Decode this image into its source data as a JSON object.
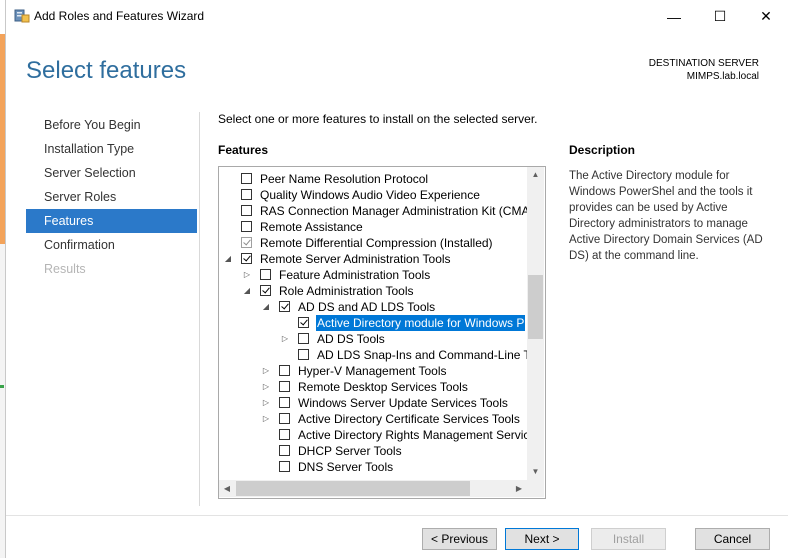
{
  "window": {
    "title": "Add Roles and Features Wizard",
    "controls": {
      "minimize": "—",
      "maximize": "☐",
      "close": "✕"
    }
  },
  "header": {
    "page_title": "Select features",
    "destination_label": "DESTINATION SERVER",
    "destination_server": "MIMPS.lab.local"
  },
  "nav": {
    "items": [
      {
        "label": "Before You Begin",
        "state": "normal"
      },
      {
        "label": "Installation Type",
        "state": "normal"
      },
      {
        "label": "Server Selection",
        "state": "normal"
      },
      {
        "label": "Server Roles",
        "state": "normal"
      },
      {
        "label": "Features",
        "state": "selected"
      },
      {
        "label": "Confirmation",
        "state": "normal"
      },
      {
        "label": "Results",
        "state": "disabled"
      }
    ]
  },
  "main": {
    "instruction": "Select one or more features to install on the selected server.",
    "features_heading": "Features",
    "features": [
      {
        "label": "Peer Name Resolution Protocol",
        "level": 0,
        "expander": "none",
        "checked": false,
        "disabled": false
      },
      {
        "label": "Quality Windows Audio Video Experience",
        "level": 0,
        "expander": "none",
        "checked": false,
        "disabled": false
      },
      {
        "label": "RAS Connection Manager Administration Kit (CMA",
        "level": 0,
        "expander": "none",
        "checked": false,
        "disabled": false
      },
      {
        "label": "Remote Assistance",
        "level": 0,
        "expander": "none",
        "checked": false,
        "disabled": false
      },
      {
        "label": "Remote Differential Compression (Installed)",
        "level": 0,
        "expander": "none",
        "checked": true,
        "disabled": true
      },
      {
        "label": "Remote Server Administration Tools",
        "level": 0,
        "expander": "expanded",
        "checked": true,
        "disabled": false
      },
      {
        "label": "Feature Administration Tools",
        "level": 1,
        "expander": "collapsed",
        "checked": false,
        "disabled": false
      },
      {
        "label": "Role Administration Tools",
        "level": 1,
        "expander": "expanded",
        "checked": true,
        "disabled": false
      },
      {
        "label": "AD DS and AD LDS Tools",
        "level": 2,
        "expander": "expanded",
        "checked": true,
        "disabled": false
      },
      {
        "label": "Active Directory module for Windows P",
        "level": 3,
        "expander": "none",
        "checked": true,
        "disabled": false,
        "highlighted": true
      },
      {
        "label": "AD DS Tools",
        "level": 3,
        "expander": "collapsed",
        "checked": false,
        "disabled": false
      },
      {
        "label": "AD LDS Snap-Ins and Command-Line To",
        "level": 3,
        "expander": "none",
        "checked": false,
        "disabled": false
      },
      {
        "label": "Hyper-V Management Tools",
        "level": 2,
        "expander": "collapsed",
        "checked": false,
        "disabled": false
      },
      {
        "label": "Remote Desktop Services Tools",
        "level": 2,
        "expander": "collapsed",
        "checked": false,
        "disabled": false
      },
      {
        "label": "Windows Server Update Services Tools",
        "level": 2,
        "expander": "collapsed",
        "checked": false,
        "disabled": false
      },
      {
        "label": "Active Directory Certificate Services Tools",
        "level": 2,
        "expander": "collapsed",
        "checked": false,
        "disabled": false
      },
      {
        "label": "Active Directory Rights Management Servic",
        "level": 2,
        "expander": "none",
        "checked": false,
        "disabled": false
      },
      {
        "label": "DHCP Server Tools",
        "level": 2,
        "expander": "none",
        "checked": false,
        "disabled": false
      },
      {
        "label": "DNS Server Tools",
        "level": 2,
        "expander": "none",
        "checked": false,
        "disabled": false
      }
    ],
    "description_heading": "Description",
    "description_text": "The Active Directory module for Windows PowerShel and the tools it provides can be used by Active Directory administrators to manage Active Directory Domain Services (AD DS) at the command line."
  },
  "buttons": {
    "previous": "< Previous",
    "next": "Next >",
    "install": "Install",
    "cancel": "Cancel"
  },
  "icons": {
    "app": "server-manager-icon",
    "expanded": "◢",
    "collapsed": "▷",
    "scroll_up": "▲",
    "scroll_down": "▼",
    "scroll_left": "◀",
    "scroll_right": "▶"
  },
  "colors": {
    "title_blue": "#2f6e9e",
    "selected_nav": "#2b79c9",
    "highlight": "#0078d7"
  }
}
